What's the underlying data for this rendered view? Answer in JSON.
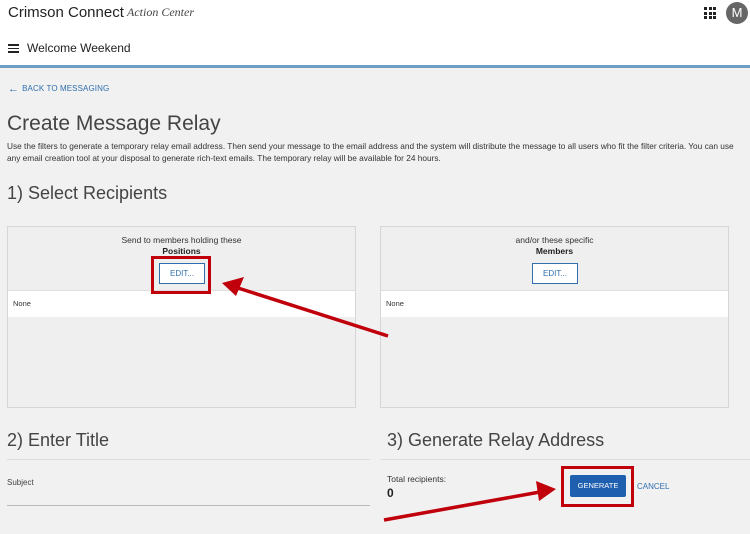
{
  "app": {
    "title": "Crimson Connect",
    "subtitle": "Action Center",
    "avatar_initial": "M"
  },
  "subbar": {
    "title": "Welcome Weekend"
  },
  "nav": {
    "back_label": "BACK TO MESSAGING"
  },
  "page": {
    "title": "Create Message Relay",
    "intro": "Use the filters to generate a temporary relay email address. Then send your message to the email address and the system will distribute the message to all users who fit the filter criteria. You can use any email creation tool at your disposal to generate rich-text emails. The temporary relay will be available for 24 hours."
  },
  "section1": {
    "heading": "1) Select Recipients",
    "positions": {
      "caption": "Send to members holding these",
      "bold": "Positions",
      "edit_label": "EDIT...",
      "list_value": "None"
    },
    "members": {
      "caption": "and/or these specific",
      "bold": "Members",
      "edit_label": "EDIT...",
      "list_value": "None"
    }
  },
  "section2": {
    "heading": "2) Enter Title",
    "subject_label": "Subject"
  },
  "section3": {
    "heading": "3) Generate Relay Address",
    "total_label": "Total recipients:",
    "total_value": "0",
    "generate_label": "GENERATE",
    "cancel_label": "CANCEL"
  },
  "colors": {
    "accent": "#2f6fae",
    "primary_button": "#1f5fb0",
    "annotation": "#c0000b"
  },
  "icons": {
    "apps": "grid-icon",
    "menu": "hamburger-menu-icon",
    "back": "arrow-left-icon"
  }
}
